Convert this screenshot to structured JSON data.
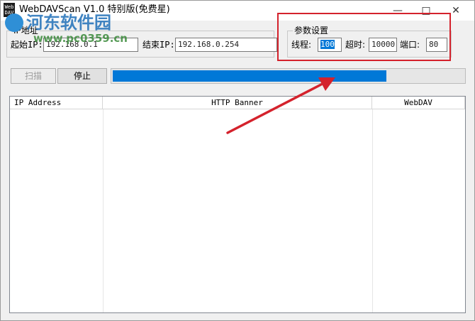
{
  "window": {
    "title": "WebDAVScan V1.0 特别版(免费星)",
    "icon_text": "Web DAV",
    "controls": {
      "minimize": "—",
      "maximize": "□",
      "close": "✕"
    }
  },
  "watermark": {
    "title": "河东软件园",
    "url": "www.pc0359.cn"
  },
  "ip_group": {
    "title": "IP地址",
    "start_label": "起始IP:",
    "start_value": "192.168.0.1",
    "end_label": "结束IP:",
    "end_value": "192.168.0.254"
  },
  "params": {
    "title": "参数设置",
    "threads_label": "线程:",
    "threads_value": "100",
    "timeout_label": "超时:",
    "timeout_value": "10000",
    "port_label": "端口:",
    "port_value": "80"
  },
  "actions": {
    "scan_label": "扫描",
    "stop_label": "停止"
  },
  "progress": {
    "percent": 78
  },
  "results": {
    "columns": [
      "IP Address",
      "HTTP Banner",
      "WebDAV"
    ],
    "rows": []
  },
  "colors": {
    "accent": "#0078d7",
    "highlight_box": "#d4222c",
    "arrow": "#d4222c"
  },
  "icons": {
    "app": "webdav-app-icon",
    "watermark_logo": "pc0359-logo"
  }
}
